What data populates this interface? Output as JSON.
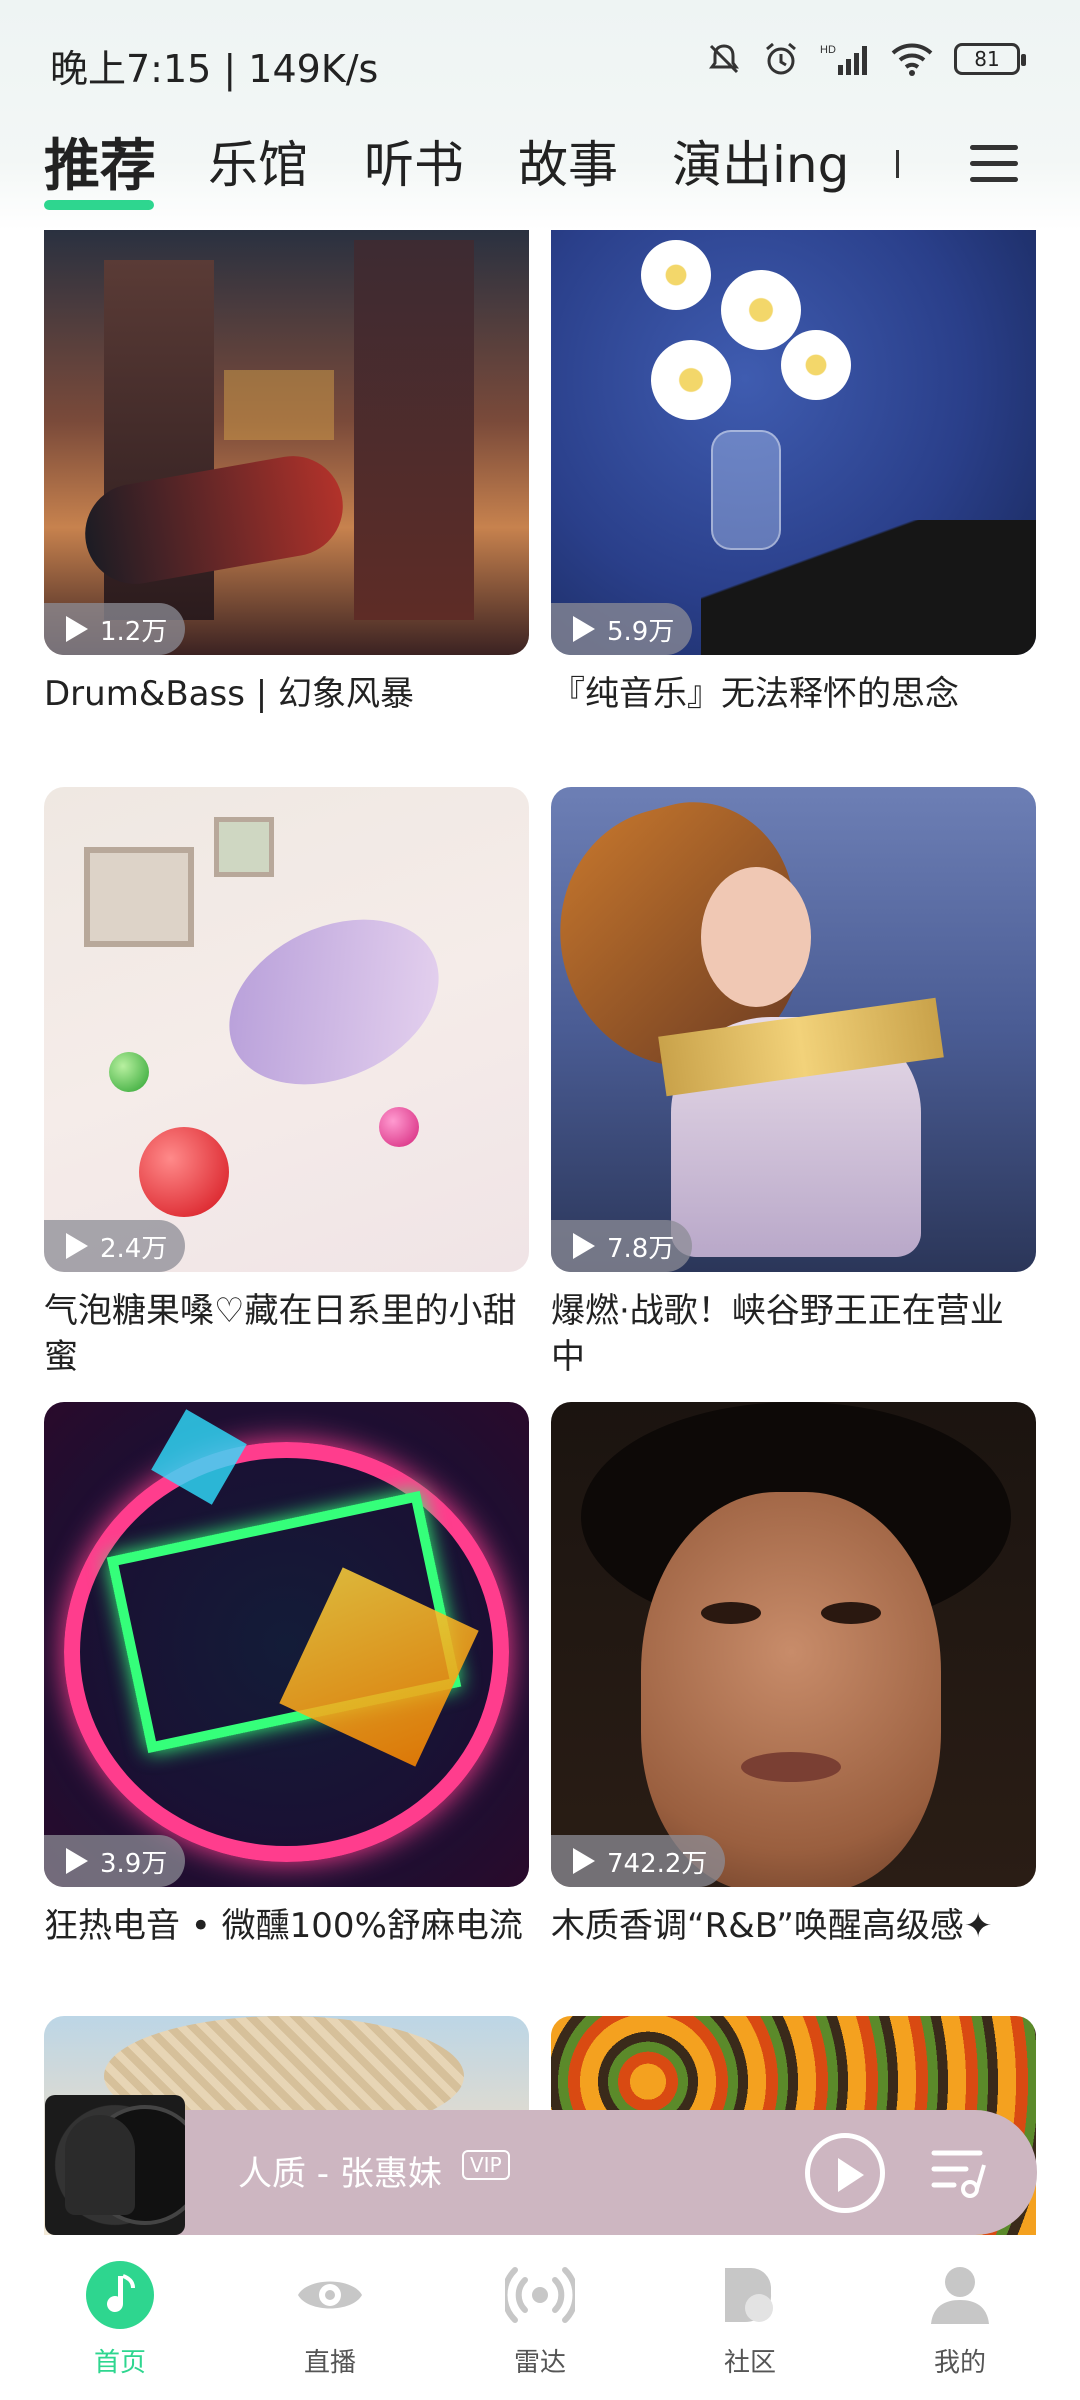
{
  "status_bar": {
    "time": "晚上7:15 | 149K/s",
    "battery": "81",
    "network": "HD"
  },
  "tabs": [
    {
      "label": "推荐",
      "active": true
    },
    {
      "label": "乐馆",
      "active": false
    },
    {
      "label": "听书",
      "active": false
    },
    {
      "label": "故事",
      "active": false
    },
    {
      "label": "演出ing",
      "active": false
    }
  ],
  "feed": [
    {
      "play_count": "1.2万",
      "title": "Drum&Bass | 幻象风暴"
    },
    {
      "play_count": "5.9万",
      "title": "『纯音乐』无法释怀的思念"
    },
    {
      "play_count": "2.4万",
      "title": "气泡糖果嗓♡藏在日系里的小甜蜜"
    },
    {
      "play_count": "7.8万",
      "title": "爆燃·战歌！峡谷野王正在营业中"
    },
    {
      "play_count": "3.9万",
      "title": "狂热电音 • 微醺100%舒麻电流"
    },
    {
      "play_count": "742.2万",
      "title": "木质香调“R&B”唤醒高级感✦"
    }
  ],
  "mini_player": {
    "title": "人质 - 张惠妹",
    "badge": "VIP"
  },
  "bottom_nav": [
    {
      "label": "首页",
      "icon": "music-note-icon",
      "active": true
    },
    {
      "label": "直播",
      "icon": "eye-icon",
      "active": false
    },
    {
      "label": "雷达",
      "icon": "radar-icon",
      "active": false
    },
    {
      "label": "社区",
      "icon": "community-icon",
      "active": false
    },
    {
      "label": "我的",
      "icon": "profile-icon",
      "active": false
    }
  ],
  "colors": {
    "accent": "#2ed68f",
    "mini_player_bg": "#cdb6c1"
  }
}
